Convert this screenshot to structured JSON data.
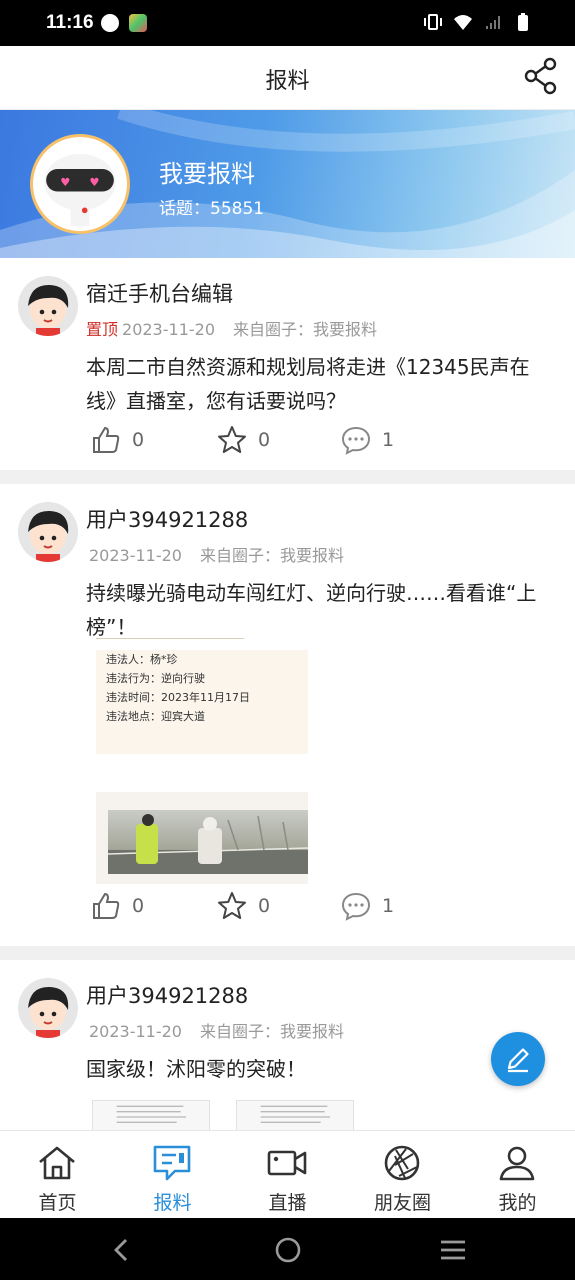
{
  "status_bar": {
    "time": "11:16"
  },
  "header": {
    "title": "报料"
  },
  "banner": {
    "title": "我要报料",
    "topic_label": "话题：",
    "topic_count": "55851"
  },
  "posts": [
    {
      "author": "宿迁手机台编辑",
      "pinned": "置顶",
      "date": "2023-11-20",
      "from": "来自圈子：我要报料",
      "text": "本周二市自然资源和规划局将走进《12345民声在线》直播室，您有话要说吗？",
      "likes": "0",
      "favorites": "0",
      "comments": "1"
    },
    {
      "author": "用户394921288",
      "date": "2023-11-20",
      "from": "来自圈子：我要报料",
      "text": "持续曝光骑电动车闯红灯、逆向行驶……看看谁“上榜”！",
      "image_lines": [
        "违法人：杨*珍",
        "违法行为：逆向行驶",
        "违法时间：2023年11月17日",
        "违法地点：迎宾大道"
      ],
      "likes": "0",
      "favorites": "0",
      "comments": "1"
    },
    {
      "author": "用户394921288",
      "date": "2023-11-20",
      "from": "来自圈子：我要报料",
      "text": "国家级！沭阳零的突破！"
    }
  ],
  "tabs": [
    {
      "label": "首页",
      "icon": "home-icon"
    },
    {
      "label": "报料",
      "icon": "report-icon",
      "active": true
    },
    {
      "label": "直播",
      "icon": "live-camera-icon"
    },
    {
      "label": "朋友圈",
      "icon": "aperture-icon"
    },
    {
      "label": "我的",
      "icon": "user-icon"
    }
  ],
  "colors": {
    "accent": "#2a8fd8",
    "pinned": "#d0302a",
    "fab": "#1f8fdf"
  }
}
